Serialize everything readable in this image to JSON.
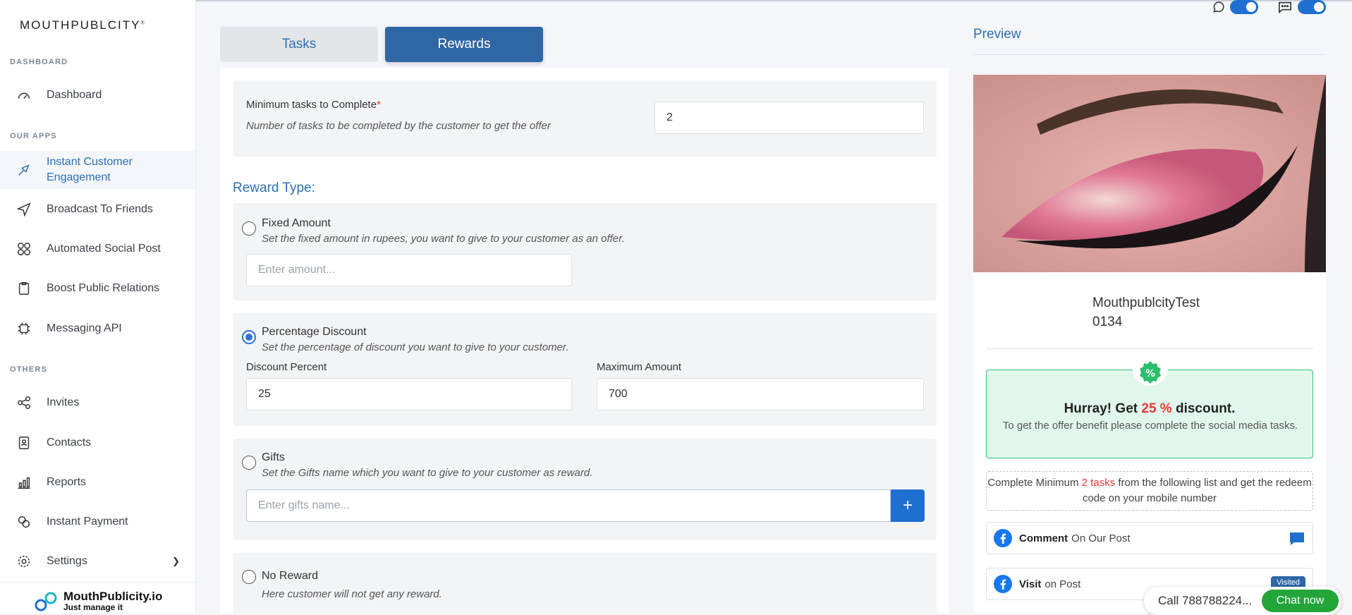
{
  "sidebar": {
    "brand": "MOUTHPUBLCITY",
    "brand_mark": "®",
    "sections": {
      "dashboard": "DASHBOARD",
      "apps": "OUR APPS",
      "others": "OTHERS"
    },
    "items": [
      {
        "label": "Dashboard",
        "icon": "gauge-icon"
      },
      {
        "label": "Instant Customer Engagement",
        "icon": "megaphone-icon"
      },
      {
        "label": "Broadcast To Friends",
        "icon": "send-icon"
      },
      {
        "label": "Automated Social Post",
        "icon": "social-grid-icon"
      },
      {
        "label": "Boost Public Relations",
        "icon": "clipboard-icon"
      },
      {
        "label": "Messaging API",
        "icon": "api-icon"
      },
      {
        "label": "Invites",
        "icon": "share-icon"
      },
      {
        "label": "Contacts",
        "icon": "contact-card-icon"
      },
      {
        "label": "Reports",
        "icon": "bar-chart-icon"
      },
      {
        "label": "Instant Payment",
        "icon": "payment-icon"
      },
      {
        "label": "Settings",
        "icon": "gear-icon"
      }
    ],
    "footer_logo": {
      "name": "MouthPublicity.io",
      "tagline": "Just manage it"
    }
  },
  "tabs": {
    "tasks": "Tasks",
    "rewards": "Rewards"
  },
  "form": {
    "min_tasks": {
      "label": "Minimum tasks to Complete",
      "required_mark": "*",
      "hint": "Number of tasks to be completed by the customer to get the offer",
      "value": "2"
    },
    "reward_type_heading": "Reward Type:",
    "fixed": {
      "title": "Fixed Amount",
      "hint": "Set the fixed amount in rupees, you want to give to your customer as an offer.",
      "placeholder": "Enter amount..."
    },
    "percentage": {
      "title": "Percentage Discount",
      "hint": "Set the percentage of discount you want to give to your customer.",
      "discount_label": "Discount Percent",
      "discount_value": "25",
      "max_label": "Maximum Amount",
      "max_value": "700"
    },
    "gifts": {
      "title": "Gifts",
      "hint": "Set the Gifts name which you want to give to your customer as reward.",
      "placeholder": "Enter gifts name...",
      "add": "+"
    },
    "none": {
      "title": "No Reward",
      "hint": "Here customer will not get any reward."
    },
    "selected": "percentage"
  },
  "preview": {
    "title": "Preview",
    "business_name": "MouthpublcityTest",
    "business_code": "0134",
    "offer_prefix": "Hurray! Get ",
    "offer_value": "25 %",
    "offer_suffix": " discount.",
    "offer_sub": "To get the offer benefit please complete the social media tasks.",
    "min_prefix": "Complete Minimum ",
    "min_count": "2 tasks",
    "min_suffix": " from the following list and get the redeem code on your mobile number",
    "tasks": [
      {
        "bold": "Comment",
        "rest": "On Our Post",
        "icon": "facebook-icon",
        "status_icon": "comment-icon"
      },
      {
        "bold": "Visit",
        "rest": "on Post",
        "icon": "facebook-icon",
        "status": "Visited"
      }
    ]
  },
  "chat": {
    "call": "Call 788788224...",
    "button": "Chat now"
  },
  "colors": {
    "accent": "#2e6fb5",
    "primary_button": "#2f66a6",
    "success": "#34c279",
    "danger": "#e53935"
  }
}
